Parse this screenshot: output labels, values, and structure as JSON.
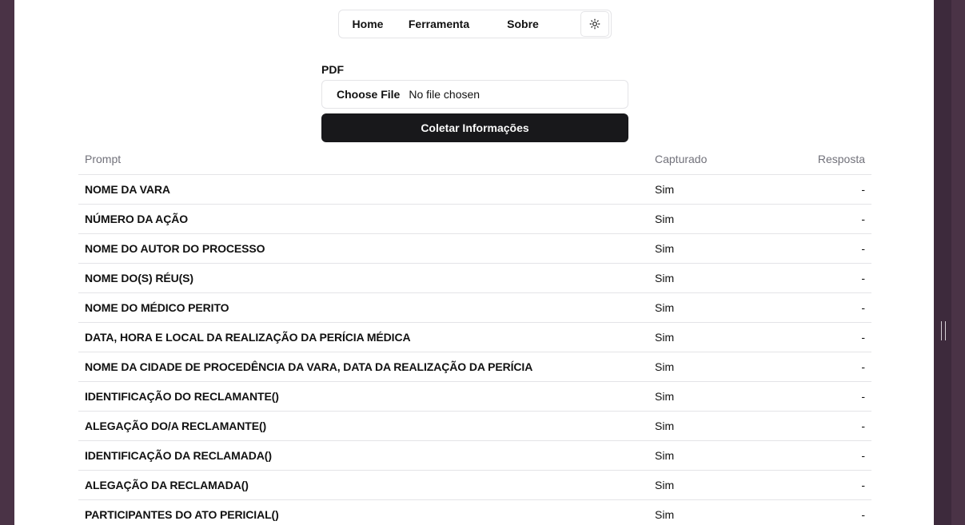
{
  "nav": {
    "items": [
      "Home",
      "Ferramenta",
      "Sobre"
    ],
    "theme_icon": "sun-icon"
  },
  "form": {
    "label": "PDF",
    "file_button": "Choose File",
    "file_status": "No file chosen",
    "submit_label": "Coletar Informações"
  },
  "table": {
    "headers": [
      "Prompt",
      "Capturado",
      "Resposta"
    ],
    "rows": [
      {
        "prompt": "NOME DA VARA",
        "captured": "Sim",
        "answer": "-"
      },
      {
        "prompt": "NÚMERO DA AÇÃO",
        "captured": "Sim",
        "answer": "-"
      },
      {
        "prompt": "NOME DO AUTOR DO PROCESSO",
        "captured": "Sim",
        "answer": "-"
      },
      {
        "prompt": "NOME DO(S) RÉU(S)",
        "captured": "Sim",
        "answer": "-"
      },
      {
        "prompt": "NOME DO MÉDICO PERITO",
        "captured": "Sim",
        "answer": "-"
      },
      {
        "prompt": "DATA, HORA E LOCAL DA REALIZAÇÃO DA PERÍCIA MÉDICA",
        "captured": "Sim",
        "answer": "-"
      },
      {
        "prompt": "NOME DA CIDADE DE PROCEDÊNCIA DA VARA, DATA DA REALIZAÇÃO DA PERÍCIA",
        "captured": "Sim",
        "answer": "-"
      },
      {
        "prompt": "IDENTIFICAÇÃO DO RECLAMANTE()",
        "captured": "Sim",
        "answer": "-"
      },
      {
        "prompt": "ALEGAÇÃO DO/A RECLAMANTE()",
        "captured": "Sim",
        "answer": "-"
      },
      {
        "prompt": "IDENTIFICAÇÃO DA RECLAMADA()",
        "captured": "Sim",
        "answer": "-"
      },
      {
        "prompt": "ALEGAÇÃO DA RECLAMADA()",
        "captured": "Sim",
        "answer": "-"
      },
      {
        "prompt": "PARTICIPANTES DO ATO PERICIAL()",
        "captured": "Sim",
        "answer": "-"
      }
    ]
  }
}
